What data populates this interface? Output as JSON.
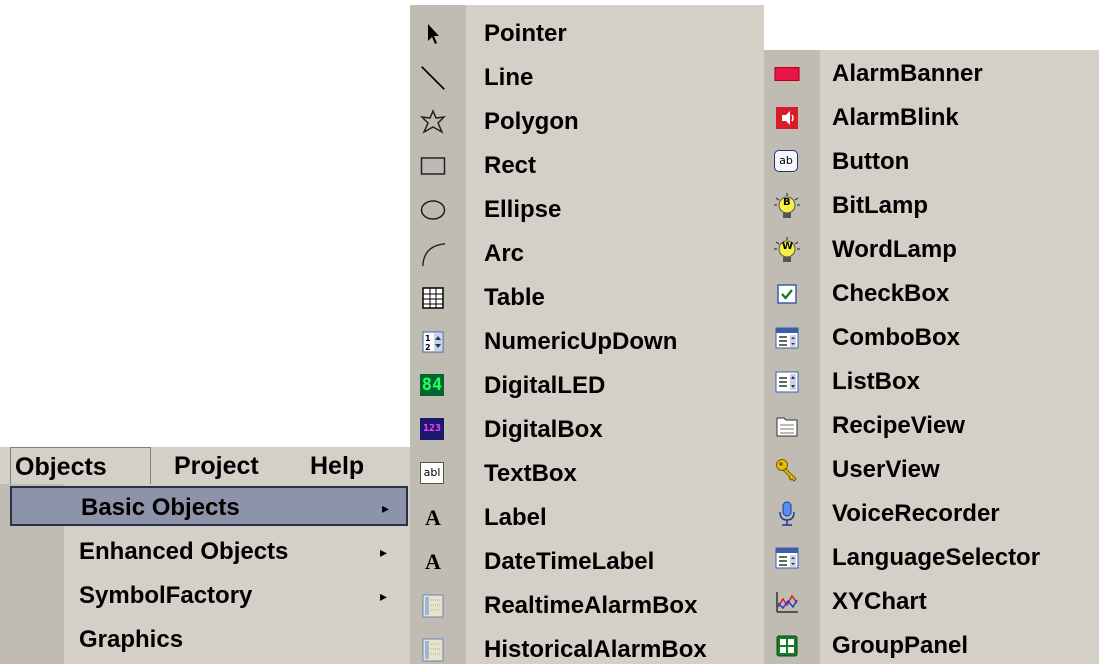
{
  "menubar": {
    "items": [
      {
        "label": "Objects"
      },
      {
        "label": "Project"
      },
      {
        "label": "Help"
      }
    ]
  },
  "objects_menu": {
    "items": [
      {
        "label": "Basic Objects",
        "arrow": "▸",
        "selected": true
      },
      {
        "label": "Enhanced Objects",
        "arrow": "▸"
      },
      {
        "label": "SymbolFactory",
        "arrow": "▸"
      },
      {
        "label": "Graphics"
      }
    ]
  },
  "basic_objects": {
    "items": [
      {
        "label": "Pointer",
        "icon": "pointer-icon"
      },
      {
        "label": "Line",
        "icon": "line-icon"
      },
      {
        "label": "Polygon",
        "icon": "polygon-icon"
      },
      {
        "label": "Rect",
        "icon": "rect-icon"
      },
      {
        "label": "Ellipse",
        "icon": "ellipse-icon"
      },
      {
        "label": "Arc",
        "icon": "arc-icon"
      },
      {
        "label": "Table",
        "icon": "table-icon"
      },
      {
        "label": "NumericUpDown",
        "icon": "numeric-updown-icon"
      },
      {
        "label": "DigitalLED",
        "icon": "digital-led-icon",
        "icon_text": "84"
      },
      {
        "label": "DigitalBox",
        "icon": "digital-box-icon",
        "icon_text": "123"
      },
      {
        "label": "TextBox",
        "icon": "textbox-icon",
        "icon_text": "abl"
      },
      {
        "label": "Label",
        "icon": "label-icon",
        "icon_text": "A"
      },
      {
        "label": "DateTimeLabel",
        "icon": "datetime-label-icon",
        "icon_text": "A"
      },
      {
        "label": "RealtimeAlarmBox",
        "icon": "realtime-alarmbox-icon"
      },
      {
        "label": "HistoricalAlarmBox",
        "icon": "historical-alarmbox-icon"
      }
    ]
  },
  "enhanced_objects": {
    "items": [
      {
        "label": "AlarmBanner",
        "icon": "alarm-banner-icon"
      },
      {
        "label": "AlarmBlink",
        "icon": "alarm-blink-icon"
      },
      {
        "label": "Button",
        "icon": "button-icon",
        "icon_text": "ab"
      },
      {
        "label": "BitLamp",
        "icon": "bitlamp-icon",
        "icon_text": "B"
      },
      {
        "label": "WordLamp",
        "icon": "wordlamp-icon",
        "icon_text": "W"
      },
      {
        "label": "CheckBox",
        "icon": "checkbox-icon"
      },
      {
        "label": "ComboBox",
        "icon": "combobox-icon"
      },
      {
        "label": "ListBox",
        "icon": "listbox-icon"
      },
      {
        "label": "RecipeView",
        "icon": "recipeview-icon"
      },
      {
        "label": "UserView",
        "icon": "userview-icon"
      },
      {
        "label": "VoiceRecorder",
        "icon": "voice-recorder-icon"
      },
      {
        "label": "LanguageSelector",
        "icon": "language-selector-icon"
      },
      {
        "label": "XYChart",
        "icon": "xychart-icon"
      },
      {
        "label": "GroupPanel",
        "icon": "grouppanel-icon"
      }
    ]
  },
  "colors": {
    "menu_bg": "#d4d0c8",
    "selected_bg": "#8d93a8",
    "selected_border": "#2a2f4a"
  }
}
